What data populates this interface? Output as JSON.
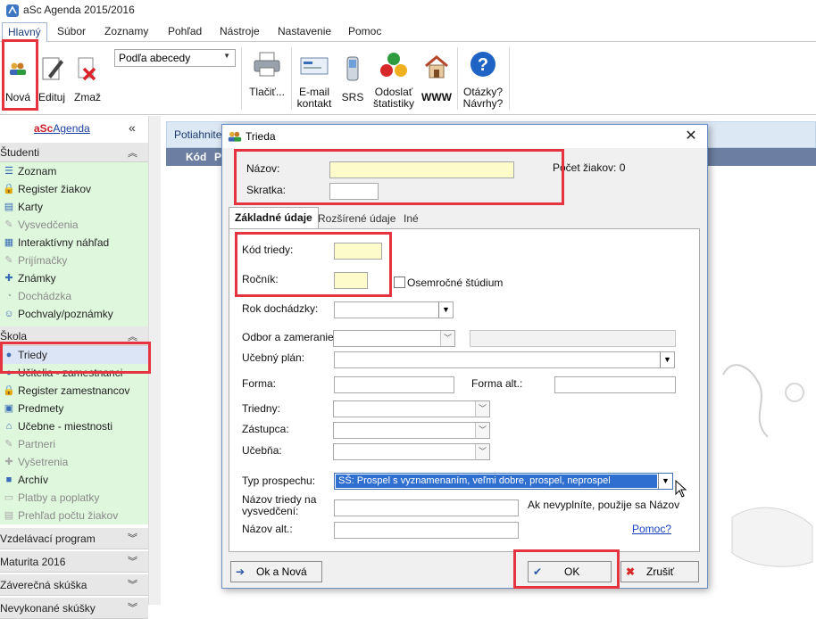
{
  "window": {
    "title": "aSc Agenda 2015/2016"
  },
  "tabs": [
    "Hlavný",
    "Súbor",
    "Zoznamy",
    "Pohľad",
    "Nástroje",
    "Nastavenie",
    "Pomoc"
  ],
  "ribbon": {
    "new_label": "Nová",
    "edit_label": "Edituj",
    "delete_label": "Zmaž",
    "sort_value": "Podľa abecedy",
    "print_label": "Tlačiť...",
    "email_label_1": "E-mail",
    "email_label_2": "kontakt",
    "srs_label": "SRS",
    "stats_label_1": "Odoslať",
    "stats_label_2": "štatistiky",
    "www_label": "WWW",
    "help_label_1": "Otázky?",
    "help_label_2": "Návrhy?"
  },
  "sidebar": {
    "logo_prefix": "aSc",
    "logo_suffix": "Agenda",
    "collapse": "«",
    "students_header": "Študenti",
    "students": [
      {
        "label": "Zoznam",
        "icon": "list-icon",
        "disabled": false
      },
      {
        "label": "Register žiakov",
        "icon": "register-icon",
        "disabled": false
      },
      {
        "label": "Karty",
        "icon": "card-icon",
        "disabled": false
      },
      {
        "label": "Vysvedčenia",
        "icon": "certificate-icon",
        "disabled": true
      },
      {
        "label": "Interaktívny náhľad",
        "icon": "preview-icon",
        "disabled": false
      },
      {
        "label": "Prijímačky",
        "icon": "admission-icon",
        "disabled": true
      },
      {
        "label": "Známky",
        "icon": "grades-icon",
        "disabled": false
      },
      {
        "label": "Dochádzka",
        "icon": "attendance-icon",
        "disabled": true
      },
      {
        "label": "Pochvaly/poznámky",
        "icon": "praise-icon",
        "disabled": false
      }
    ],
    "school_header": "Škola",
    "school": [
      {
        "label": "Triedy",
        "icon": "classes-icon",
        "disabled": false
      },
      {
        "label": "Učitelia - zamestnanci",
        "icon": "teachers-icon",
        "disabled": false
      },
      {
        "label": "Register zamestnancov",
        "icon": "register-icon",
        "disabled": false
      },
      {
        "label": "Predmety",
        "icon": "subjects-icon",
        "disabled": false
      },
      {
        "label": "Učebne - miestnosti",
        "icon": "room-icon",
        "disabled": false
      },
      {
        "label": "Partneri",
        "icon": "partners-icon",
        "disabled": true
      },
      {
        "label": "Vyšetrenia",
        "icon": "medical-icon",
        "disabled": true
      },
      {
        "label": "Archív",
        "icon": "archive-icon",
        "disabled": false
      },
      {
        "label": "Platby a poplatky",
        "icon": "payments-icon",
        "disabled": true
      },
      {
        "label": "Prehľad počtu žiakov",
        "icon": "overview-icon",
        "disabled": true
      }
    ],
    "bottom_headers": [
      "Vzdelávací program",
      "Maturita 2016",
      "Záverečná skúška",
      "Nevykonané skúšky"
    ]
  },
  "main": {
    "drag_hint": "Potiahnite",
    "col_code": "Kód",
    "col_next": "P"
  },
  "dialog": {
    "title": "Trieda",
    "name_label": "Názov:",
    "short_label": "Skratka:",
    "student_count": "Počet žiakov: 0",
    "tabs": [
      "Základné údaje",
      "Rozšírené údaje",
      "Iné"
    ],
    "class_code_label": "Kód triedy:",
    "year_label": "Ročník:",
    "eight_year_label": "Osemročné štúdium",
    "attendance_year_label": "Rok dochádzky:",
    "field_label": "Odbor a zameranie:",
    "plan_label": "Učebný plán:",
    "form_label": "Forma:",
    "form_alt_label": "Forma alt.:",
    "teacher_label": "Triedny:",
    "deputy_label": "Zástupca:",
    "room_label": "Učebňa:",
    "progress_type_label": "Typ prospechu:",
    "progress_type_value": "SŠ: Prospel s vyznamenaním, veľmi dobre, prospel, neprospel",
    "cert_name_label_1": "Názov triedy na",
    "cert_name_label_2": "vysvedčení:",
    "cert_hint": "Ak nevyplníte, použije sa Názov",
    "alt_name_label": "Názov alt.:",
    "help_link": "Pomoc?",
    "ok_new_button": "Ok a Nová",
    "ok_button": "OK",
    "cancel_button": "Zrušiť"
  }
}
